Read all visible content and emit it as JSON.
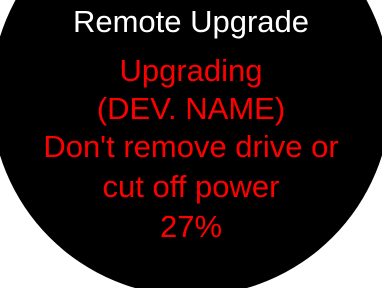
{
  "screen": {
    "title": "Remote Upgrade",
    "status": "Upgrading",
    "device_name": "(DEV. NAME)",
    "warning_line1": "Don't remove drive or",
    "warning_line2": "cut off power",
    "progress_text": "27%",
    "progress": 0.27
  },
  "colors": {
    "background": "#000000",
    "title": "#ffffff",
    "message": "#ff0000"
  }
}
